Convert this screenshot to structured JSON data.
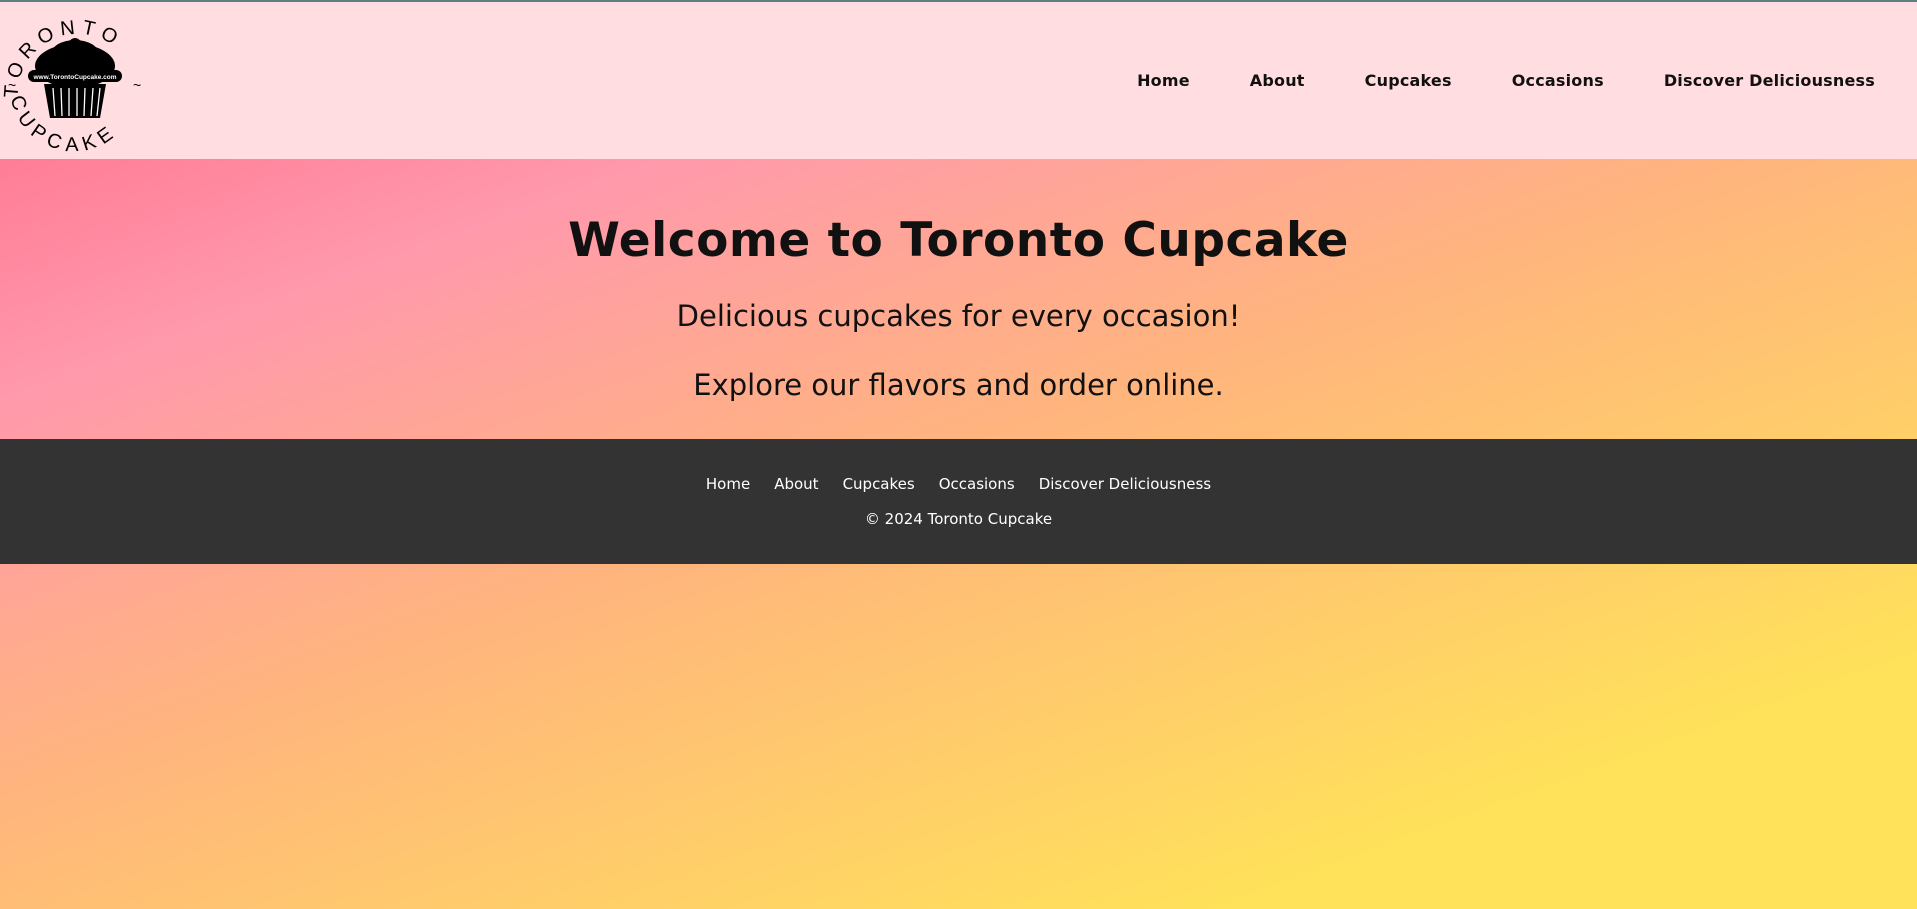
{
  "logo": {
    "ring_top": "TORONTO",
    "ring_bottom": "CUPCAKE",
    "url_text": "www.TorontoCupcake.com",
    "icon": "cupcake-icon"
  },
  "nav": {
    "items": [
      "Home",
      "About",
      "Cupcakes",
      "Occasions",
      "Discover Deliciousness"
    ]
  },
  "hero": {
    "title": "Welcome to Toronto Cupcake",
    "line1": "Delicious cupcakes for every occasion!",
    "line2": "Explore our flavors and order online."
  },
  "footer": {
    "items": [
      "Home",
      "About",
      "Cupcakes",
      "Occasions",
      "Discover Deliciousness"
    ],
    "copyright": "© 2024 Toronto Cupcake"
  },
  "colors": {
    "header_bg": "#ffdde1",
    "footer_bg": "#333333",
    "gradient_start": "#ff6a88",
    "gradient_end": "#ffe259"
  }
}
